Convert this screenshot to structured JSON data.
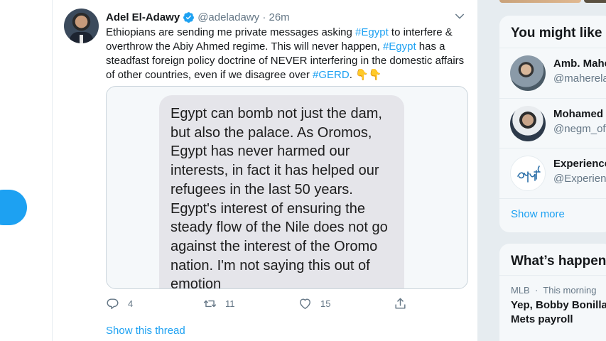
{
  "tweet": {
    "author_name": "Adel El-Adawy",
    "handle": "@adeladawy",
    "separator": "·",
    "time": "26m",
    "text_segments": [
      {
        "text": "Ethiopians are sending me private messages asking ",
        "type": "text"
      },
      {
        "text": "#Egypt",
        "type": "link"
      },
      {
        "text": " to interfere & overthrow the Abiy Ahmed regime. This will never happen, ",
        "type": "text"
      },
      {
        "text": "#Egypt",
        "type": "link"
      },
      {
        "text": " has a steadfast foreign policy doctrine of NEVER interfering in the domestic affairs of other countries, even if we disagree over ",
        "type": "text"
      },
      {
        "text": "#GERD",
        "type": "link"
      },
      {
        "text": ". ",
        "type": "text"
      },
      {
        "text": "👇👇",
        "type": "emoji"
      }
    ],
    "image_text": "Egypt can bomb not just the dam, but also the palace. As Oromos, Egypt has never harmed our interests, in fact it has helped our refugees in the last 50 years. Egypt's interest of ensuring the steady flow of the Nile does not go against the interest of the Oromo nation. I'm not saying this out of emotion",
    "reply_count": "4",
    "retweet_count": "11",
    "like_count": "15",
    "show_thread": "Show this thread"
  },
  "sidebar": {
    "who_to_follow": {
      "title": "You might like",
      "accounts": [
        {
          "name": "Amb. Mahe",
          "handle": "@maherela"
        },
        {
          "name": "Mohamed",
          "handle": "@negm_off"
        },
        {
          "name": "Experience",
          "handle": "@Experienc"
        }
      ],
      "show_more": "Show more"
    },
    "trends": {
      "title": "What’s happen",
      "items": [
        {
          "category": "MLB",
          "separator": "·",
          "time": "This morning",
          "text": "Yep, Bobby Bonilla Mets payroll"
        }
      ]
    }
  },
  "colors": {
    "accent": "#1da1f2",
    "text_primary": "#14171a",
    "text_secondary": "#657786",
    "background": "#e6ecf0"
  }
}
